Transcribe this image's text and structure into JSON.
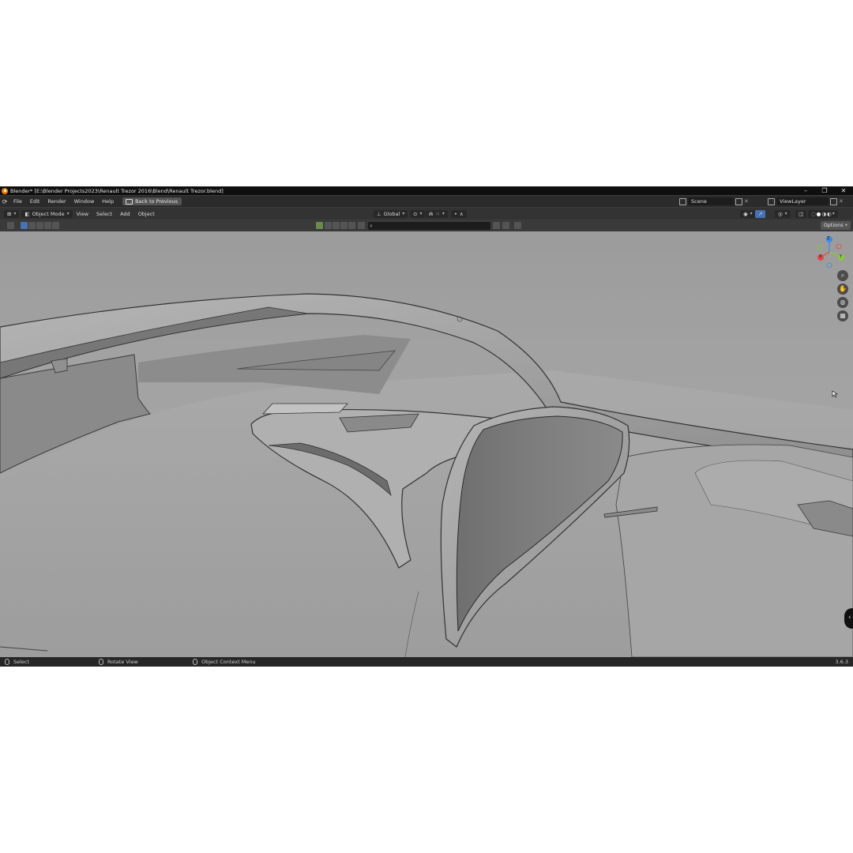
{
  "window": {
    "title": "Blender* [E:\\Blender Projects2023\\Renault Trezor 2016\\Blend\\Renault Trezor.blend]",
    "controls": [
      "–",
      "❐",
      "✕"
    ]
  },
  "topbar": {
    "menus": [
      "File",
      "Edit",
      "Render",
      "Window",
      "Help"
    ],
    "back_to_previous": "Back to Previous",
    "scene": "Scene",
    "view_layer": "ViewLayer"
  },
  "view3d_header": {
    "mode": "Object Mode",
    "menus": [
      "View",
      "Select",
      "Add",
      "Object"
    ],
    "transform_orientation": "Global",
    "options": "Options"
  },
  "gizmo": {
    "z": "Z",
    "y": "Y",
    "x": "X"
  },
  "statusbar": {
    "select": "Select",
    "rotate_view": "Rotate View",
    "context_menu": "Object Context Menu",
    "version": "3.6.3"
  },
  "colors": {
    "accent": "#4772b3",
    "axis_x": "#e24848",
    "axis_y": "#8cc63f",
    "axis_z": "#3f8ce2",
    "viewport_bg": "#a4a4a4"
  }
}
